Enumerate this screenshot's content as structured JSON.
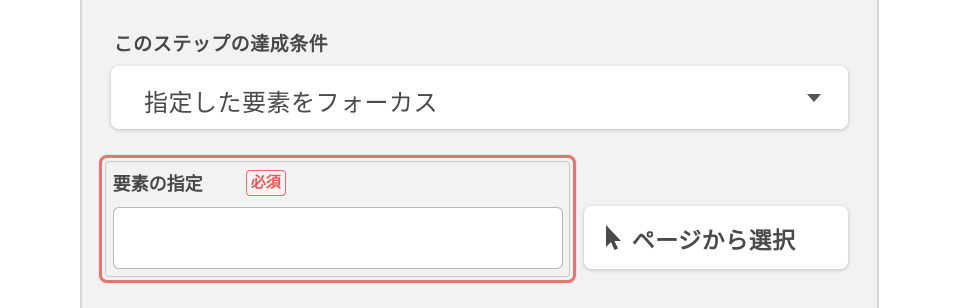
{
  "condition": {
    "label": "このステップの達成条件",
    "selected_value": "指定した要素をフォーカス"
  },
  "element_field": {
    "label": "要素の指定",
    "required_badge": "必須",
    "value": "",
    "placeholder": ""
  },
  "pick_button": {
    "label": "ページから選択",
    "icon": "cursor-arrow-icon"
  },
  "colors": {
    "panel_bg": "#f2f2f2",
    "error_border": "#e57575",
    "required_text": "#e05a5a",
    "text": "#474747"
  }
}
